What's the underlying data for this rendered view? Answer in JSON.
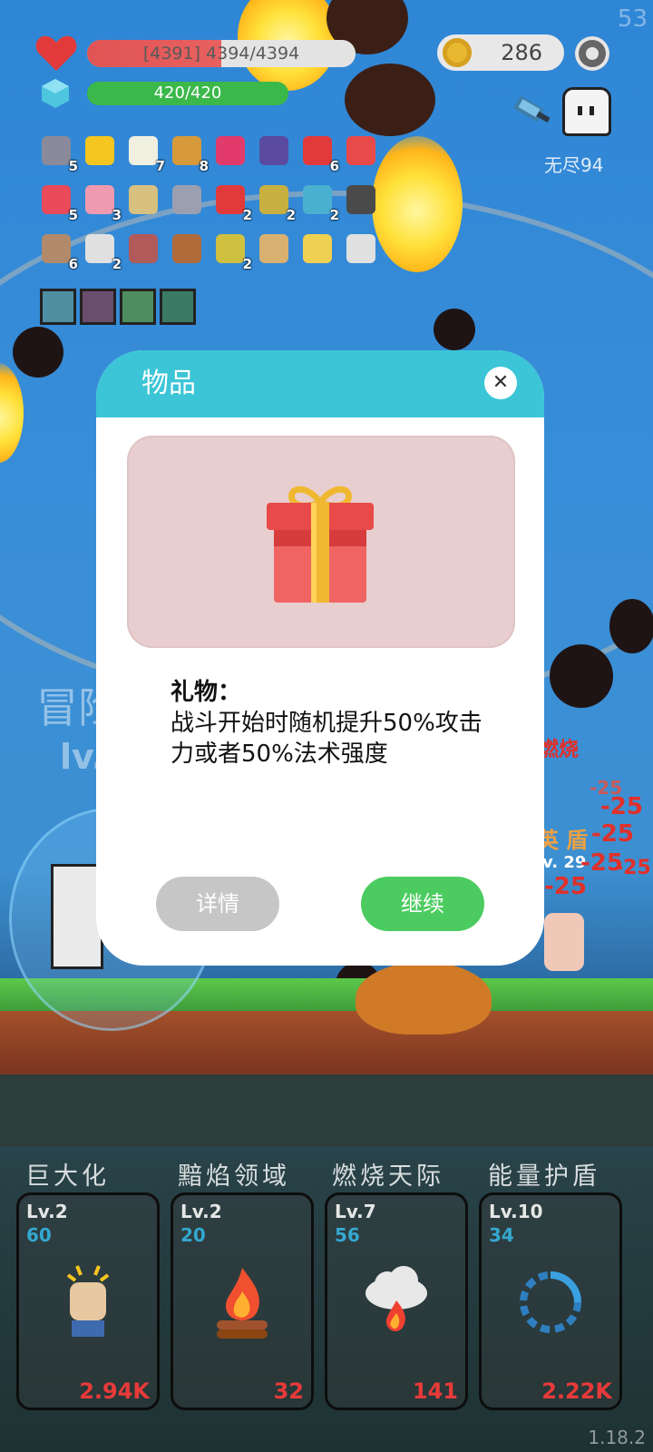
{
  "status": {
    "fps": "53",
    "hp_text": "[4391] 4394/4394",
    "hp_fraction": 0.5,
    "mp_text": "420/420",
    "mp_fraction": 1.0,
    "coins": "286",
    "mode_label": "无尽94"
  },
  "inventory": {
    "items": [
      {
        "icon": "sword-icon",
        "count": "5"
      },
      {
        "icon": "sun-icon",
        "count": ""
      },
      {
        "icon": "flower-icon",
        "count": "7"
      },
      {
        "icon": "book-icon",
        "count": "8"
      },
      {
        "icon": "ruby-icon",
        "count": ""
      },
      {
        "icon": "wizard-hat-icon",
        "count": ""
      },
      {
        "icon": "apple-icon",
        "count": "6"
      },
      {
        "icon": "gift-icon",
        "count": ""
      },
      {
        "icon": "watermelon-icon",
        "count": "5"
      },
      {
        "icon": "ice-cream-icon",
        "count": "3"
      },
      {
        "icon": "treasure-map-icon",
        "count": ""
      },
      {
        "icon": "spike-ball-icon",
        "count": ""
      },
      {
        "icon": "strawberry-icon",
        "count": "2"
      },
      {
        "icon": "pineapple-icon",
        "count": "2"
      },
      {
        "icon": "syringe-icon",
        "count": "2"
      },
      {
        "icon": "skull-book-icon",
        "count": ""
      },
      {
        "icon": "shield-icon",
        "count": "6"
      },
      {
        "icon": "envelope-icon",
        "count": "2"
      },
      {
        "icon": "door-icon",
        "count": ""
      },
      {
        "icon": "meat-icon",
        "count": ""
      },
      {
        "icon": "battery-icon",
        "count": "2"
      },
      {
        "icon": "scroll-icon",
        "count": ""
      },
      {
        "icon": "cheese-icon",
        "count": ""
      },
      {
        "icon": "pill-icon",
        "count": ""
      }
    ],
    "cards": [
      "sun-card-icon",
      "sword-card-icon",
      "check-card-icon",
      "maze-card-icon"
    ]
  },
  "background": {
    "big_text": "冒险",
    "lv_text": "lv.",
    "enemy_texts": [
      "燃烧",
      "英 盾",
      "v. 29"
    ],
    "damage_numbers": [
      "-25",
      "-25",
      "-25",
      "-25",
      "-25",
      "-25"
    ]
  },
  "modal": {
    "title": "物品",
    "close_icon": "close-icon",
    "item_icon": "gift-icon",
    "item_name": "礼物：",
    "item_description": "战斗开始时随机提升50%攻击力或者50%法术强度",
    "details_button": "详情",
    "continue_button": "继续"
  },
  "skills": [
    {
      "name": "巨大化",
      "level": "Lv.2",
      "cost": "60",
      "damage": "2.94K",
      "icon": "fist-icon"
    },
    {
      "name": "黯焰领域",
      "level": "Lv.2",
      "cost": "20",
      "damage": "32",
      "icon": "campfire-icon"
    },
    {
      "name": "燃烧天际",
      "level": "Lv.7",
      "cost": "56",
      "damage": "141",
      "icon": "fire-cloud-icon"
    },
    {
      "name": "能量护盾",
      "level": "Lv.10",
      "cost": "34",
      "damage": "2.22K",
      "icon": "shield-ring-icon"
    }
  ],
  "version": "1.18.2",
  "colors": {
    "modal_header": "#3bc5d6",
    "continue_button": "#4ccc60",
    "details_button": "#c6c6c6",
    "hp_bar": "#e05454",
    "mp_bar": "#3bb84a",
    "damage_text": "#e83a3a",
    "skill_cost": "#34a8d0"
  }
}
